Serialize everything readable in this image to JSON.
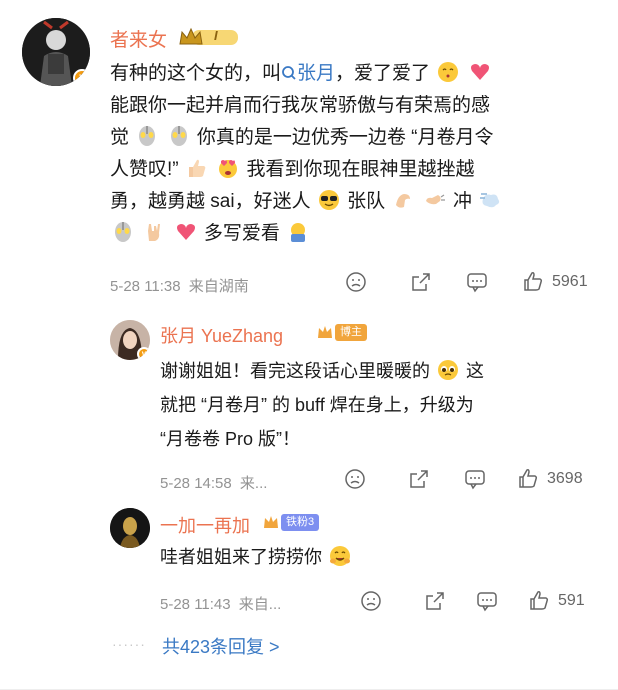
{
  "main_comment": {
    "username": "者来女",
    "level_badge": "I",
    "text_1": "有种的这个女的，叫",
    "mention": "张月",
    "text_2": "，爱了爱了",
    "line_2": "能跟你一起并肩而行我灰常骄傲与有荣焉的感",
    "line_3a": "觉",
    "line_3b": "你真的是一边优秀一边卷 “月卷月令",
    "line_4a": "人赞叹!”",
    "line_4b": "我看到你现在眼神里越挫越",
    "line_5a": "勇，越勇越 sai，好迷人",
    "line_5b": "张队",
    "line_5c": "冲",
    "line_6": "多写爱看",
    "timestamp": "5-28 11:38",
    "location": "来自湖南",
    "like_count": "5961"
  },
  "reply_1": {
    "username": "张月 YueZhang",
    "badge": "博主",
    "line_1": "谢谢姐姐！看完这段话心里暖暖的",
    "line_1b": "这",
    "line_2": "就把 “月卷月” 的 buff 焊在身上，升级为",
    "line_3": "“月卷卷 Pro 版”！",
    "timestamp": "5-28 14:58",
    "location": "来...",
    "like_count": "3698"
  },
  "reply_2": {
    "username": "一加一再加",
    "badge": "铁粉3",
    "text": "哇者姐姐来了捞捞你",
    "timestamp": "5-28 11:43",
    "location": "来自...",
    "like_count": "591"
  },
  "more_replies": {
    "label": "共423条回复 >"
  },
  "colors": {
    "username": "#eb7350",
    "link": "#3a79c4",
    "meta": "#939393"
  },
  "icons": [
    "v-badge-icon",
    "crown-icon",
    "search-link-icon",
    "sad-face-icon",
    "share-icon",
    "comment-icon",
    "like-icon"
  ]
}
